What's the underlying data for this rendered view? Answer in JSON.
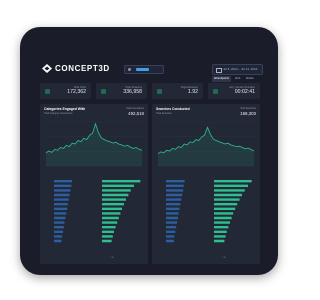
{
  "app": {
    "brand": "CONCEPT3D"
  },
  "header": {
    "date_range": "Jul 8, 2024 – Jul 14, 2024",
    "toggles": [
      "All Endpoints",
      "Web",
      "Mobile"
    ]
  },
  "kpis": [
    {
      "label": "Total Visits",
      "value": "172,362",
      "icon": "visits-icon"
    },
    {
      "label": "Total Sessions",
      "value": "336,958",
      "icon": "sessions-icon"
    },
    {
      "label": "Pages/Session",
      "value": "1.92",
      "icon": "pages-icon"
    },
    {
      "label": "Avg. Session Duration",
      "value": "00:02:41",
      "icon": "duration-icon"
    }
  ],
  "panels": [
    {
      "title": "Categories Engaged With",
      "subtitle": "Total Category Interactions",
      "total_label": "Total Interactions",
      "total": "492,518"
    },
    {
      "title": "Searches Conducted",
      "subtitle": "Total Searches",
      "total_label": "Total Searches",
      "total": "158,303"
    }
  ],
  "colors": {
    "background": "#1a1d29",
    "card": "#232837",
    "line": "#2fbf8f",
    "bar_blue": "#2d5f9e",
    "bar_green": "#2fbf8f",
    "accent": "#3fa0e6"
  },
  "chart_data": [
    {
      "type": "line",
      "series": [
        {
          "values": [
            30,
            34,
            31,
            38,
            36,
            42,
            40,
            47,
            44,
            52,
            50,
            58,
            55,
            63,
            60,
            70,
            74,
            96,
            76,
            64,
            60,
            57,
            55,
            52,
            54,
            50,
            48,
            45,
            47,
            43,
            40,
            42,
            38,
            36
          ]
        }
      ]
    },
    {
      "type": "line",
      "series": [
        {
          "values": [
            28,
            32,
            30,
            36,
            34,
            40,
            38,
            44,
            42,
            50,
            48,
            55,
            53,
            60,
            58,
            66,
            70,
            88,
            72,
            61,
            58,
            55,
            53,
            50,
            52,
            48,
            46,
            44,
            45,
            42,
            39,
            41,
            37,
            35
          ]
        }
      ]
    },
    {
      "type": "bar",
      "orientation": "horizontal",
      "series": [
        {
          "values": [
            60,
            58,
            55,
            52,
            49,
            46,
            44,
            41,
            38,
            35,
            33,
            30,
            27,
            25
          ]
        },
        {
          "values": [
            96,
            80,
            72,
            66,
            60,
            55,
            50,
            46,
            42,
            38,
            34,
            30,
            27,
            24
          ]
        }
      ]
    },
    {
      "type": "bar",
      "orientation": "horizontal",
      "series": [
        {
          "values": [
            62,
            59,
            57,
            54,
            51,
            48,
            45,
            42,
            40,
            37,
            34,
            31,
            28,
            26
          ]
        },
        {
          "values": [
            94,
            85,
            77,
            70,
            64,
            58,
            53,
            48,
            44,
            40,
            36,
            32,
            29,
            26
          ]
        }
      ]
    }
  ]
}
